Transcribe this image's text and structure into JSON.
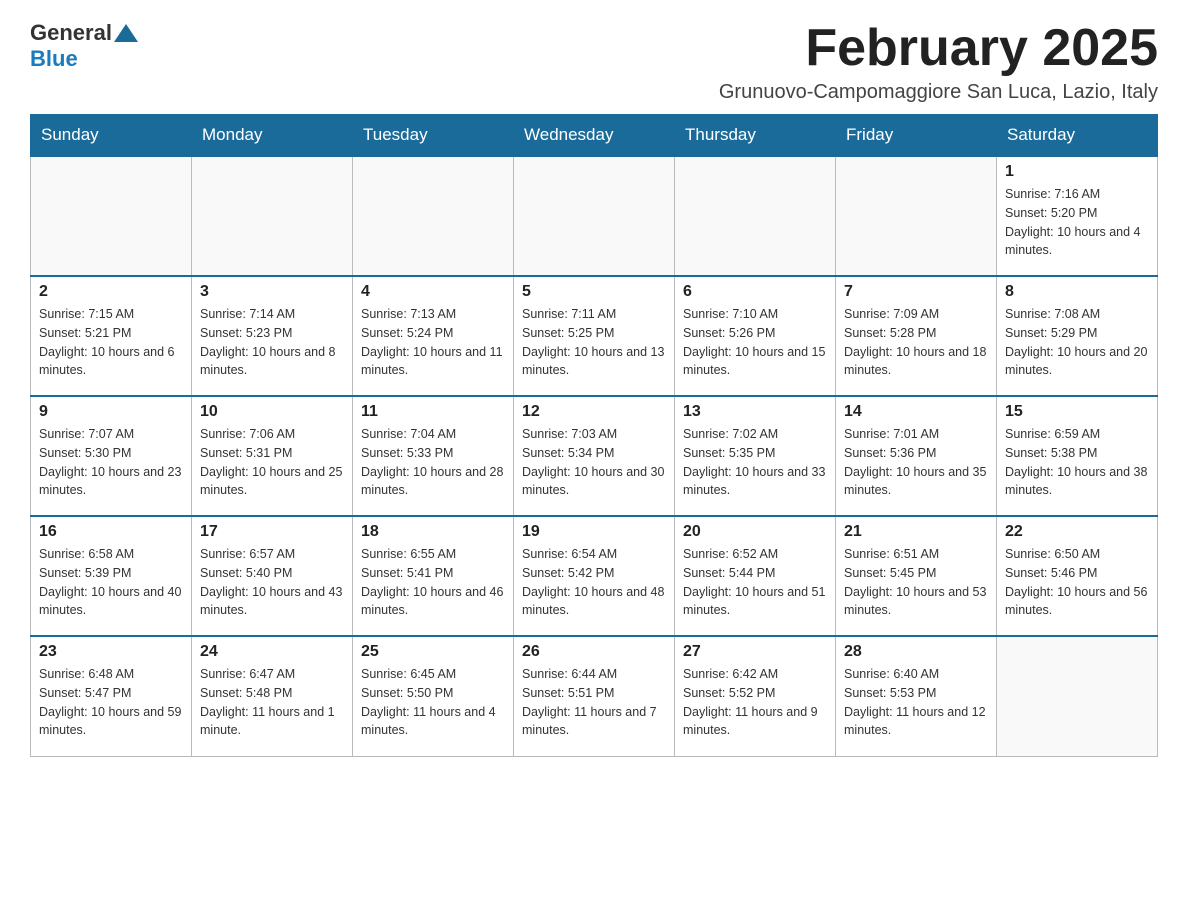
{
  "header": {
    "logo_general": "General",
    "logo_blue": "Blue",
    "month_title": "February 2025",
    "location": "Grunuovo-Campomaggiore San Luca, Lazio, Italy"
  },
  "days_of_week": [
    "Sunday",
    "Monday",
    "Tuesday",
    "Wednesday",
    "Thursday",
    "Friday",
    "Saturday"
  ],
  "weeks": [
    [
      {
        "day": "",
        "info": ""
      },
      {
        "day": "",
        "info": ""
      },
      {
        "day": "",
        "info": ""
      },
      {
        "day": "",
        "info": ""
      },
      {
        "day": "",
        "info": ""
      },
      {
        "day": "",
        "info": ""
      },
      {
        "day": "1",
        "info": "Sunrise: 7:16 AM\nSunset: 5:20 PM\nDaylight: 10 hours and 4 minutes."
      }
    ],
    [
      {
        "day": "2",
        "info": "Sunrise: 7:15 AM\nSunset: 5:21 PM\nDaylight: 10 hours and 6 minutes."
      },
      {
        "day": "3",
        "info": "Sunrise: 7:14 AM\nSunset: 5:23 PM\nDaylight: 10 hours and 8 minutes."
      },
      {
        "day": "4",
        "info": "Sunrise: 7:13 AM\nSunset: 5:24 PM\nDaylight: 10 hours and 11 minutes."
      },
      {
        "day": "5",
        "info": "Sunrise: 7:11 AM\nSunset: 5:25 PM\nDaylight: 10 hours and 13 minutes."
      },
      {
        "day": "6",
        "info": "Sunrise: 7:10 AM\nSunset: 5:26 PM\nDaylight: 10 hours and 15 minutes."
      },
      {
        "day": "7",
        "info": "Sunrise: 7:09 AM\nSunset: 5:28 PM\nDaylight: 10 hours and 18 minutes."
      },
      {
        "day": "8",
        "info": "Sunrise: 7:08 AM\nSunset: 5:29 PM\nDaylight: 10 hours and 20 minutes."
      }
    ],
    [
      {
        "day": "9",
        "info": "Sunrise: 7:07 AM\nSunset: 5:30 PM\nDaylight: 10 hours and 23 minutes."
      },
      {
        "day": "10",
        "info": "Sunrise: 7:06 AM\nSunset: 5:31 PM\nDaylight: 10 hours and 25 minutes."
      },
      {
        "day": "11",
        "info": "Sunrise: 7:04 AM\nSunset: 5:33 PM\nDaylight: 10 hours and 28 minutes."
      },
      {
        "day": "12",
        "info": "Sunrise: 7:03 AM\nSunset: 5:34 PM\nDaylight: 10 hours and 30 minutes."
      },
      {
        "day": "13",
        "info": "Sunrise: 7:02 AM\nSunset: 5:35 PM\nDaylight: 10 hours and 33 minutes."
      },
      {
        "day": "14",
        "info": "Sunrise: 7:01 AM\nSunset: 5:36 PM\nDaylight: 10 hours and 35 minutes."
      },
      {
        "day": "15",
        "info": "Sunrise: 6:59 AM\nSunset: 5:38 PM\nDaylight: 10 hours and 38 minutes."
      }
    ],
    [
      {
        "day": "16",
        "info": "Sunrise: 6:58 AM\nSunset: 5:39 PM\nDaylight: 10 hours and 40 minutes."
      },
      {
        "day": "17",
        "info": "Sunrise: 6:57 AM\nSunset: 5:40 PM\nDaylight: 10 hours and 43 minutes."
      },
      {
        "day": "18",
        "info": "Sunrise: 6:55 AM\nSunset: 5:41 PM\nDaylight: 10 hours and 46 minutes."
      },
      {
        "day": "19",
        "info": "Sunrise: 6:54 AM\nSunset: 5:42 PM\nDaylight: 10 hours and 48 minutes."
      },
      {
        "day": "20",
        "info": "Sunrise: 6:52 AM\nSunset: 5:44 PM\nDaylight: 10 hours and 51 minutes."
      },
      {
        "day": "21",
        "info": "Sunrise: 6:51 AM\nSunset: 5:45 PM\nDaylight: 10 hours and 53 minutes."
      },
      {
        "day": "22",
        "info": "Sunrise: 6:50 AM\nSunset: 5:46 PM\nDaylight: 10 hours and 56 minutes."
      }
    ],
    [
      {
        "day": "23",
        "info": "Sunrise: 6:48 AM\nSunset: 5:47 PM\nDaylight: 10 hours and 59 minutes."
      },
      {
        "day": "24",
        "info": "Sunrise: 6:47 AM\nSunset: 5:48 PM\nDaylight: 11 hours and 1 minute."
      },
      {
        "day": "25",
        "info": "Sunrise: 6:45 AM\nSunset: 5:50 PM\nDaylight: 11 hours and 4 minutes."
      },
      {
        "day": "26",
        "info": "Sunrise: 6:44 AM\nSunset: 5:51 PM\nDaylight: 11 hours and 7 minutes."
      },
      {
        "day": "27",
        "info": "Sunrise: 6:42 AM\nSunset: 5:52 PM\nDaylight: 11 hours and 9 minutes."
      },
      {
        "day": "28",
        "info": "Sunrise: 6:40 AM\nSunset: 5:53 PM\nDaylight: 11 hours and 12 minutes."
      },
      {
        "day": "",
        "info": ""
      }
    ]
  ]
}
